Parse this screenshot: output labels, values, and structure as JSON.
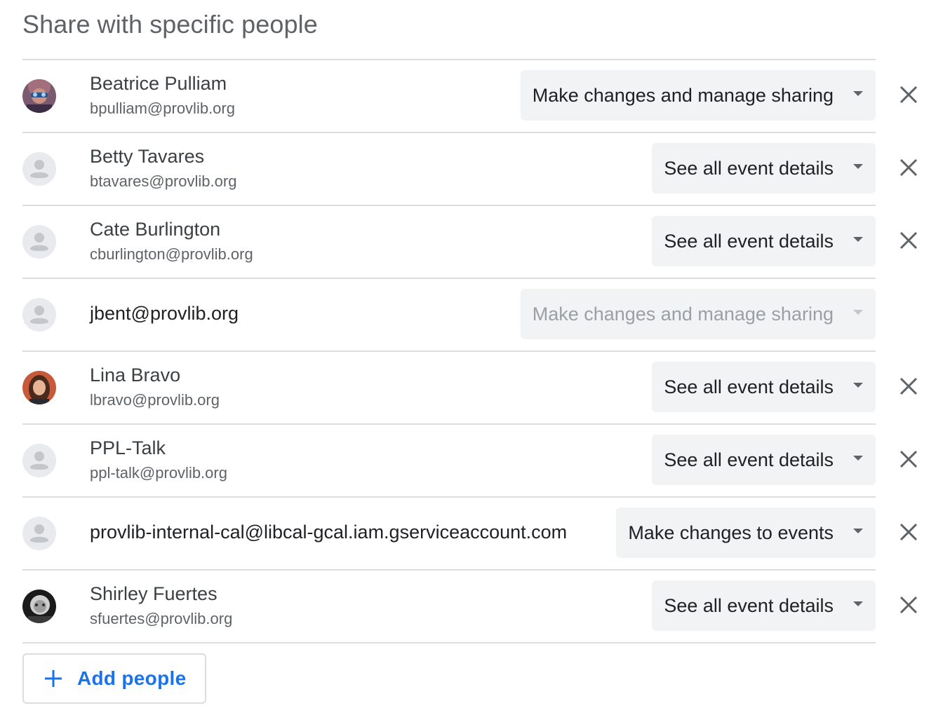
{
  "section": {
    "title": "Share with specific people"
  },
  "people": [
    {
      "name": "Beatrice Pulliam",
      "email": "bpulliam@provlib.org",
      "permission": "Make changes and manage sharing",
      "permission_disabled": false,
      "removable": true,
      "avatar": "photo-bp"
    },
    {
      "name": "Betty Tavares",
      "email": "btavares@provlib.org",
      "permission": "See all event details",
      "permission_disabled": false,
      "removable": true,
      "avatar": "default-person-icon"
    },
    {
      "name": "Cate Burlington",
      "email": "cburlington@provlib.org",
      "permission": "See all event details",
      "permission_disabled": false,
      "removable": true,
      "avatar": "default-person-icon"
    },
    {
      "name": "",
      "email": "jbent@provlib.org",
      "permission": "Make changes and manage sharing",
      "permission_disabled": true,
      "removable": false,
      "avatar": "default-person-icon"
    },
    {
      "name": "Lina Bravo",
      "email": "lbravo@provlib.org",
      "permission": "See all event details",
      "permission_disabled": false,
      "removable": true,
      "avatar": "photo-lb"
    },
    {
      "name": "PPL-Talk",
      "email": "ppl-talk@provlib.org",
      "permission": "See all event details",
      "permission_disabled": false,
      "removable": true,
      "avatar": "default-person-icon"
    },
    {
      "name": "",
      "email": "provlib-internal-cal@libcal-gcal.iam.gserviceaccount.com",
      "permission": "Make changes to events",
      "permission_disabled": false,
      "removable": true,
      "avatar": "default-person-icon"
    },
    {
      "name": "Shirley Fuertes",
      "email": "sfuertes@provlib.org",
      "permission": "See all event details",
      "permission_disabled": false,
      "removable": true,
      "avatar": "photo-sf"
    }
  ],
  "add_button": {
    "label": "Add people",
    "icon": "plus-icon"
  },
  "colors": {
    "accent": "#1a73e8",
    "divider": "#dadce0",
    "select_bg": "#f1f3f4",
    "text_primary": "#202124",
    "text_secondary": "#5f6368",
    "text_disabled": "#9aa0a6"
  }
}
